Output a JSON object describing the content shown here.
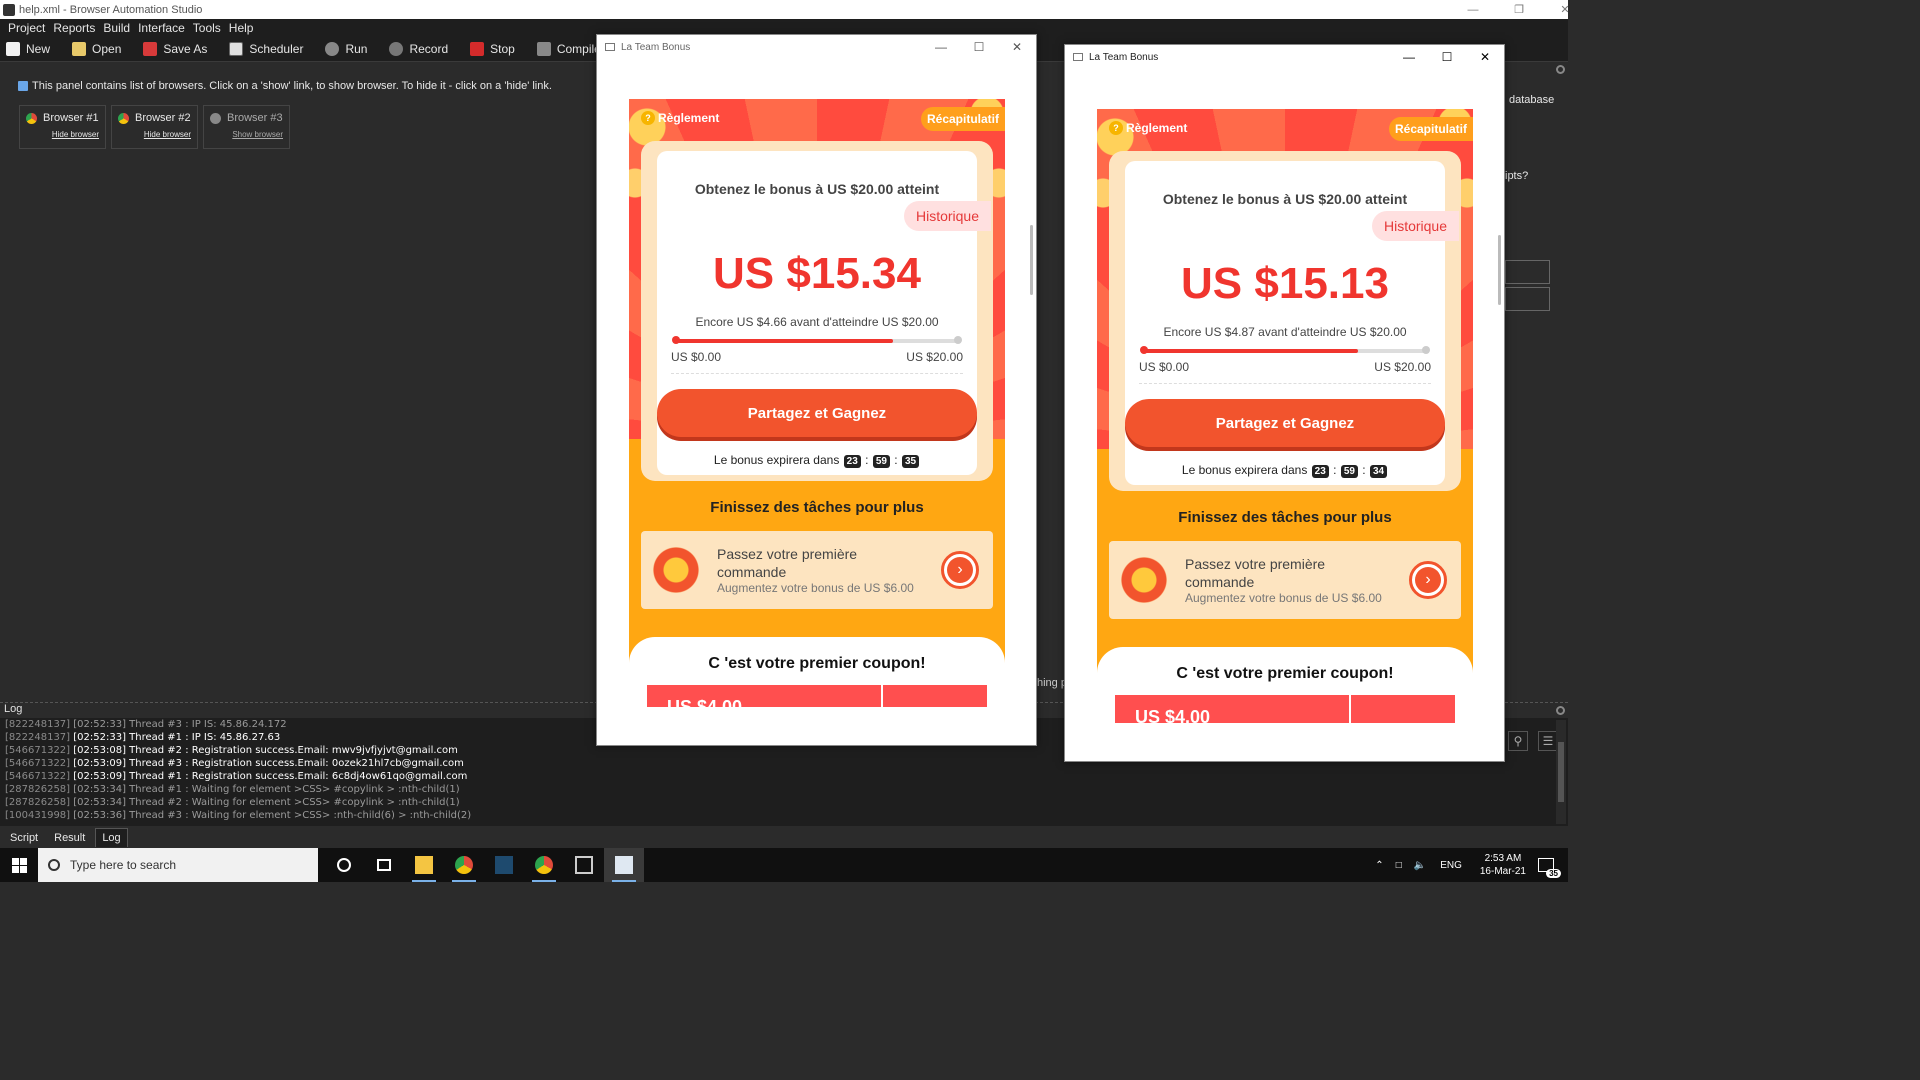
{
  "app": {
    "title": "help.xml - Browser Automation Studio",
    "menu": [
      "Project",
      "Reports",
      "Build",
      "Interface",
      "Tools",
      "Help"
    ],
    "toolbar": [
      {
        "label": "New",
        "icon": "new-file-icon"
      },
      {
        "label": "Open",
        "icon": "open-folder-icon"
      },
      {
        "label": "Save As",
        "icon": "save-icon"
      },
      {
        "label": "Scheduler",
        "icon": "calendar-icon"
      },
      {
        "label": "Run",
        "icon": "play-icon"
      },
      {
        "label": "Record",
        "icon": "record-icon"
      },
      {
        "label": "Stop",
        "icon": "stop-icon"
      },
      {
        "label": "Compile",
        "icon": "compile-icon"
      }
    ],
    "info_text": "This panel contains list of browsers. Click on a 'show' link, to show browser. To hide it - click on a 'hide' link.",
    "browsers": [
      {
        "name": "Browser #1",
        "link": "Hide browser"
      },
      {
        "name": "Browser #2",
        "link": "Hide browser"
      },
      {
        "name": "Browser #3",
        "link": "Show browser"
      }
    ],
    "side_text_database": "database",
    "side_text_ipts": "ipts?",
    "side_text_hing": "hing p",
    "log_label": "Log",
    "log_lines": [
      {
        "id": "[822248137]",
        "text": "[02:52:33] Thread #3 : IP IS: 45.86.24.172",
        "style": "dim"
      },
      {
        "id": "[822248137]",
        "text": "[02:52:33] Thread #1 : IP IS: 45.86.27.63",
        "style": "bright"
      },
      {
        "id": "[546671322]",
        "text": "[02:53:08] Thread #2 : Registration success.Email: mwv9jvfjyjvt@gmail.com",
        "style": "bright"
      },
      {
        "id": "[546671322]",
        "text": "[02:53:09] Thread #3 : Registration success.Email: 0ozek21hl7cb@gmail.com",
        "style": "bright"
      },
      {
        "id": "[546671322]",
        "text": "[02:53:09] Thread #1 : Registration success.Email: 6c8dj4ow61qo@gmail.com",
        "style": "bright"
      },
      {
        "id": "[287826258]",
        "text": "[02:53:34] Thread #1 : Waiting for element >CSS> #copylink > :nth-child(1)",
        "style": "dim"
      },
      {
        "id": "[287826258]",
        "text": "[02:53:34] Thread #2 : Waiting for element >CSS> #copylink > :nth-child(1)",
        "style": "dim"
      },
      {
        "id": "[100431998]",
        "text": "[02:53:36] Thread #3 : Waiting for element >CSS> :nth-child(6) > :nth-child(2)",
        "style": "dim"
      }
    ],
    "bottom_tabs": [
      "Script",
      "Result",
      "Log"
    ]
  },
  "popups": [
    {
      "title": "La Team Bonus",
      "reglement": "Règlement",
      "recap": "Récapitulatif",
      "goal": "Obtenez le bonus à US $20.00 atteint",
      "historique": "Historique",
      "amount": "US $15.34",
      "remaining": "Encore US $4.66 avant d'atteindre US $20.00",
      "progress_fraction": 0.767,
      "range_low": "US $0.00",
      "range_high": "US $20.00",
      "cta": "Partagez et Gagnez",
      "expire_text": "Le bonus expirera dans",
      "timer": {
        "h": "23",
        "m": "59",
        "s": "35"
      },
      "tasks_title": "Finissez des tâches pour plus",
      "task_title": "Passez votre première commande",
      "task_sub": "Augmentez votre bonus de US $6.00",
      "coupon_title": "C 'est votre premier coupon!",
      "coupon_value": "US $4.00"
    },
    {
      "title": "La Team Bonus",
      "reglement": "Règlement",
      "recap": "Récapitulatif",
      "goal": "Obtenez le bonus à US $20.00 atteint",
      "historique": "Historique",
      "amount": "US $15.13",
      "remaining": "Encore US $4.87 avant d'atteindre US $20.00",
      "progress_fraction": 0.757,
      "range_low": "US $0.00",
      "range_high": "US $20.00",
      "cta": "Partagez et Gagnez",
      "expire_text": "Le bonus expirera dans",
      "timer": {
        "h": "23",
        "m": "59",
        "s": "34"
      },
      "tasks_title": "Finissez des tâches pour plus",
      "task_title": "Passez votre première commande",
      "task_sub": "Augmentez votre bonus de US $6.00",
      "coupon_title": "C 'est votre premier coupon!",
      "coupon_value": "US $4.00"
    }
  ],
  "taskbar": {
    "search_placeholder": "Type here to search",
    "lang": "ENG",
    "time": "2:53 AM",
    "date": "16-Mar-21",
    "notifications": "35"
  },
  "colors": {
    "accent_red": "#f0352e",
    "orange_bg": "#ffa712",
    "cta": "#f2542d"
  }
}
